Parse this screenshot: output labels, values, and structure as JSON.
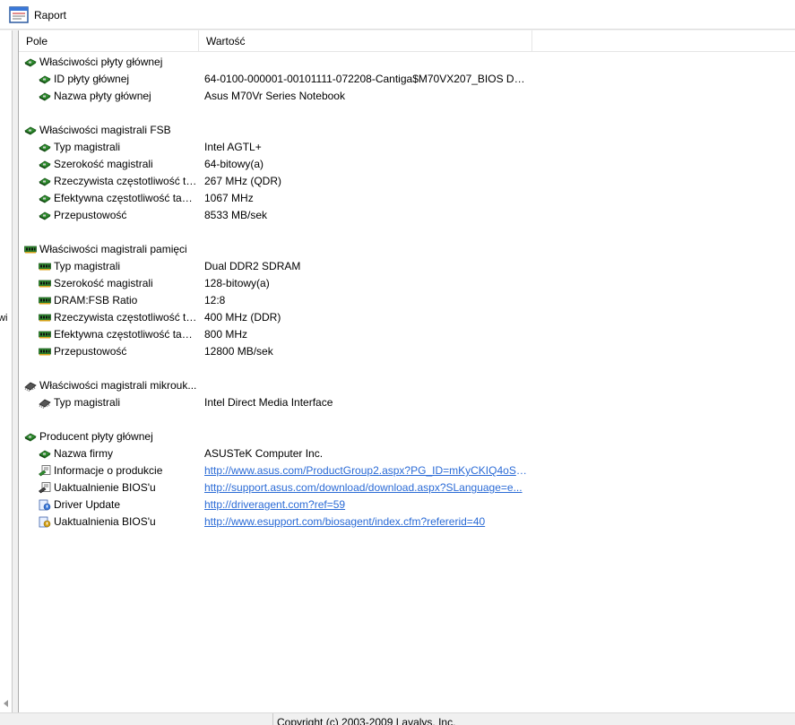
{
  "toolbar": {
    "report_label": "Raport",
    "report_icon": "report-icon"
  },
  "left_pane": {
    "clipped_text": "wi"
  },
  "columns": {
    "field": "Pole",
    "value": "Wartość"
  },
  "rows": [
    {
      "type": "group",
      "icon": "motherboard-icon",
      "field": "Właściwości płyty głównej"
    },
    {
      "type": "item",
      "icon": "motherboard-icon",
      "field": "ID płyty głównej",
      "value": "64-0100-000001-00101111-072208-Cantiga$M70VX207_BIOS DATE: ..."
    },
    {
      "type": "item",
      "icon": "motherboard-icon",
      "field": "Nazwa płyty głównej",
      "value": "Asus M70Vr Series Notebook"
    },
    {
      "type": "blank"
    },
    {
      "type": "group",
      "icon": "motherboard-icon",
      "field": "Właściwości magistrali FSB"
    },
    {
      "type": "item",
      "icon": "motherboard-icon",
      "field": "Typ magistrali",
      "value": "Intel AGTL+"
    },
    {
      "type": "item",
      "icon": "motherboard-icon",
      "field": "Szerokość magistrali",
      "value": "64-bitowy(a)"
    },
    {
      "type": "item",
      "icon": "motherboard-icon",
      "field": "Rzeczywista częstotliwość ta...",
      "value": "267 MHz (QDR)"
    },
    {
      "type": "item",
      "icon": "motherboard-icon",
      "field": "Efektywna częstotliwość takt...",
      "value": "1067 MHz"
    },
    {
      "type": "item",
      "icon": "motherboard-icon",
      "field": "Przepustowość",
      "value": "8533 MB/sek"
    },
    {
      "type": "blank"
    },
    {
      "type": "group",
      "icon": "memory-icon",
      "field": "Właściwości magistrali pamięci"
    },
    {
      "type": "item",
      "icon": "memory-icon",
      "field": "Typ magistrali",
      "value": "Dual DDR2 SDRAM"
    },
    {
      "type": "item",
      "icon": "memory-icon",
      "field": "Szerokość magistrali",
      "value": "128-bitowy(a)"
    },
    {
      "type": "item",
      "icon": "memory-icon",
      "field": "DRAM:FSB Ratio",
      "value": "12:8"
    },
    {
      "type": "item",
      "icon": "memory-icon",
      "field": "Rzeczywista częstotliwość ta...",
      "value": "400 MHz (DDR)"
    },
    {
      "type": "item",
      "icon": "memory-icon",
      "field": "Efektywna częstotliwość takt...",
      "value": "800 MHz"
    },
    {
      "type": "item",
      "icon": "memory-icon",
      "field": "Przepustowość",
      "value": "12800 MB/sek"
    },
    {
      "type": "blank"
    },
    {
      "type": "group",
      "icon": "chip-icon",
      "field": "Właściwości magistrali mikrouk..."
    },
    {
      "type": "item",
      "icon": "chip-icon",
      "field": "Typ magistrali",
      "value": "Intel Direct Media Interface"
    },
    {
      "type": "blank"
    },
    {
      "type": "group",
      "icon": "motherboard-icon",
      "field": "Producent płyty głównej"
    },
    {
      "type": "item",
      "icon": "motherboard-icon",
      "field": "Nazwa firmy",
      "value": "ASUSTeK Computer Inc."
    },
    {
      "type": "item",
      "icon": "info-link-icon",
      "field": "Informacje o produkcie",
      "value": "http://www.asus.com/ProductGroup2.aspx?PG_ID=mKyCKIQ4oSEt...",
      "link": true
    },
    {
      "type": "item",
      "icon": "bios-update-icon",
      "field": "Uaktualnienie BIOS'u",
      "value": "http://support.asus.com/download/download.aspx?SLanguage=e...",
      "link": true
    },
    {
      "type": "item",
      "icon": "driver-update-icon",
      "field": "Driver Update",
      "value": "http://driveragent.com?ref=59",
      "link": true
    },
    {
      "type": "item",
      "icon": "bios-agent-icon",
      "field": "Uaktualnienia BIOS'u",
      "value": "http://www.esupport.com/biosagent/index.cfm?refererid=40",
      "link": true
    }
  ],
  "status_bar": {
    "copyright": "Copyright (c) 2003-2009 Lavalys, Inc."
  }
}
